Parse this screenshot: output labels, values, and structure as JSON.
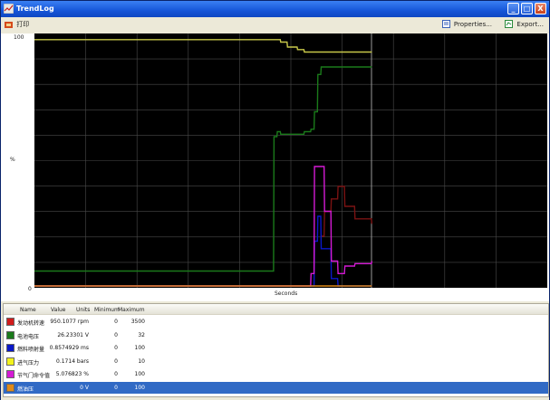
{
  "window": {
    "title": "TrendLog",
    "controls": {
      "minimize": "_",
      "maximize": "□",
      "close": "X"
    }
  },
  "toolbar": {
    "left_label": "打印",
    "properties_label": "Properties...",
    "export_label": "Export..."
  },
  "chart": {
    "y_max_label": "100",
    "y_min_label": "0",
    "y_axis_label": "%",
    "x_axis_label": "Seconds"
  },
  "table": {
    "headers": {
      "name": "Name",
      "value": "Value",
      "units": "Units",
      "minimum": "Minimum",
      "maximum": "Maximum"
    },
    "rows": [
      {
        "name": "发动机转速",
        "value": "950.1077 rpm",
        "minimum": "0",
        "maximum": "3500",
        "color": "#d11b1b",
        "selected": false
      },
      {
        "name": "电池电压",
        "value": "26.23301 V",
        "minimum": "0",
        "maximum": "32",
        "color": "#1a7a1a",
        "selected": false
      },
      {
        "name": "燃料喷射量",
        "value": "0.8574929 ms",
        "minimum": "0",
        "maximum": "100",
        "color": "#0a18c8",
        "selected": false
      },
      {
        "name": "进气压力",
        "value": "0.1714 bars",
        "minimum": "0",
        "maximum": "10",
        "color": "#f2f21c",
        "selected": false
      },
      {
        "name": "节气门命令值",
        "value": "5.076823 %",
        "minimum": "0",
        "maximum": "100",
        "color": "#d41ad4",
        "selected": false
      },
      {
        "name": "燃油压",
        "value": "0 V",
        "minimum": "0",
        "maximum": "100",
        "color": "#e08a18",
        "selected": true
      }
    ]
  },
  "chart_data": {
    "type": "line",
    "ylabel": "%",
    "xlabel": "Seconds",
    "ylim": [
      0,
      100
    ],
    "x": [
      0,
      10,
      20,
      30,
      40,
      50,
      60,
      70,
      71,
      72,
      73,
      75,
      78,
      80,
      82,
      83,
      84,
      85,
      86,
      88,
      90,
      92,
      95,
      100
    ],
    "series": [
      {
        "name": "发动机转速",
        "color": "#7a1212",
        "values": [
          null,
          null,
          null,
          null,
          null,
          null,
          null,
          null,
          null,
          null,
          null,
          null,
          null,
          null,
          null,
          null,
          null,
          20,
          30,
          35,
          40,
          32,
          27,
          25
        ]
      },
      {
        "name": "电池电压",
        "color": "#1a7a1a",
        "values": [
          6,
          6,
          6,
          6,
          6,
          6,
          6,
          6,
          60,
          62,
          61,
          61,
          61,
          62,
          63,
          70,
          85,
          88,
          88,
          88,
          88,
          88,
          88,
          88
        ]
      },
      {
        "name": "燃料喷射量",
        "color": "#0a18c8",
        "values": [
          0,
          0,
          0,
          0,
          0,
          0,
          0,
          0,
          0,
          0,
          0,
          0,
          0,
          0,
          0,
          18,
          28,
          15,
          15,
          3,
          0,
          0,
          0,
          0
        ]
      },
      {
        "name": "进气压力",
        "color": "#c8c84a",
        "values": [
          99,
          99,
          99,
          99,
          99,
          99,
          99,
          99,
          99,
          99,
          98,
          96,
          95,
          94,
          94,
          94,
          94,
          94,
          94,
          94,
          94,
          94,
          94,
          94
        ]
      },
      {
        "name": "节气门命令值",
        "color": "#d41ad4",
        "values": [
          0,
          0,
          0,
          0,
          0,
          0,
          0,
          0,
          0,
          0,
          0,
          0,
          0,
          0,
          5,
          48,
          48,
          48,
          30,
          10,
          5,
          8,
          9,
          10
        ]
      },
      {
        "name": "燃油压",
        "color": "#e08a18",
        "values": [
          0,
          0,
          0,
          0,
          0,
          0,
          0,
          0,
          0,
          0,
          0,
          0,
          0,
          0,
          0,
          0,
          0,
          0,
          0,
          0,
          0,
          0,
          0,
          0
        ]
      }
    ]
  }
}
